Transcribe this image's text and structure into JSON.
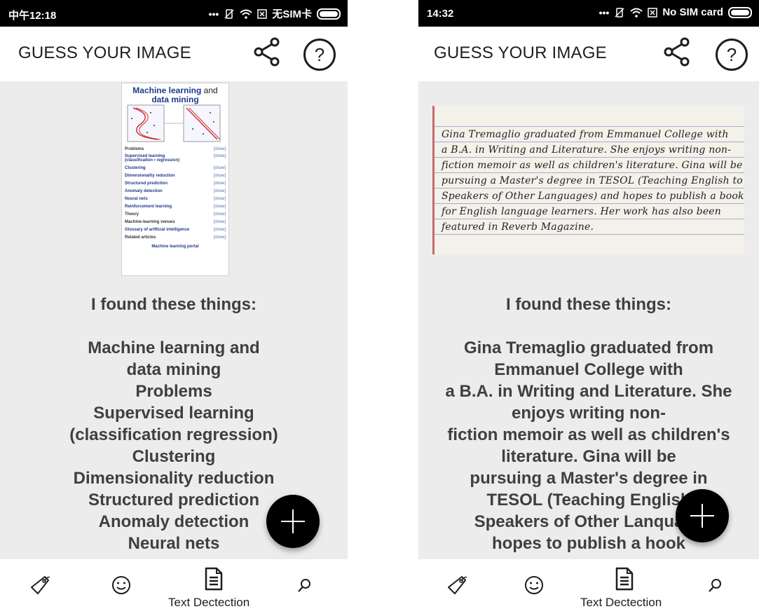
{
  "left": {
    "status": {
      "time": "中午12:18",
      "carrier": "无SIM卡"
    },
    "app_title": "GUESS YOUR IMAGE",
    "found_heading": "I found these things:",
    "result_lines": [
      "Machine learning and",
      "data mining",
      "Problems",
      "Supervised learning",
      "(classification regression)",
      "Clustering",
      "Dimensionality reduction",
      "Structured prediction",
      "Anomaly detection",
      "Neural nets"
    ],
    "thumbnail": {
      "title_a": "Machine learning",
      "title_b": "and",
      "title_c": "data mining",
      "show": "[show]",
      "rows": [
        "Problems",
        "Supervised learning",
        "(classification • regression)",
        "Clustering",
        "Dimensionality reduction",
        "Structured prediction",
        "Anomaly detection",
        "Neural nets",
        "Reinforcement learning",
        "Theory",
        "Machine-learning venues",
        "Glossary of artificial intelligence",
        "Related articles"
      ],
      "portal": "Machine learning portal"
    },
    "nav": {
      "text_label": "Text Dectection"
    }
  },
  "right": {
    "status": {
      "time": "14:32",
      "carrier": "No SIM card"
    },
    "app_title": "GUESS YOUR IMAGE",
    "found_heading": "I found these things:",
    "note_lines": [
      "Gina Tremaglio graduated from Emmanuel College with",
      "a B.A. in Writing and Literature. She enjoys writing non-",
      "fiction memoir as well as children's literature. Gina will be",
      "pursuing a Master's degree in TESOL (Teaching English to",
      "Speakers of Other Languages) and hopes to publish a book",
      "for English language learners. Her work has also been",
      "featured in Reverb Magazine."
    ],
    "result_lines": [
      "Gina Tremaglio graduated from",
      "Emmanuel College with",
      "a B.A. in Writing and Literature. She",
      "enjoys writing non-",
      "fiction memoir as well as children's",
      "literature. Gina will be",
      "pursuing a Master's degree in",
      "TESOL (Teaching English",
      "Speakers of Other Lanquage",
      "hopes to publish a hook"
    ],
    "nav": {
      "text_label": "Text Dectection"
    }
  },
  "icons": {
    "share": "share-icon",
    "help": "help-icon",
    "add": "add-icon",
    "label": "label-tag-icon",
    "smiley": "face-icon",
    "document": "document-icon",
    "search": "search-icon"
  },
  "help_glyph": "?",
  "colors": {
    "fab": "#000000",
    "content_bg": "#ececec",
    "status_bg": "#000000"
  }
}
